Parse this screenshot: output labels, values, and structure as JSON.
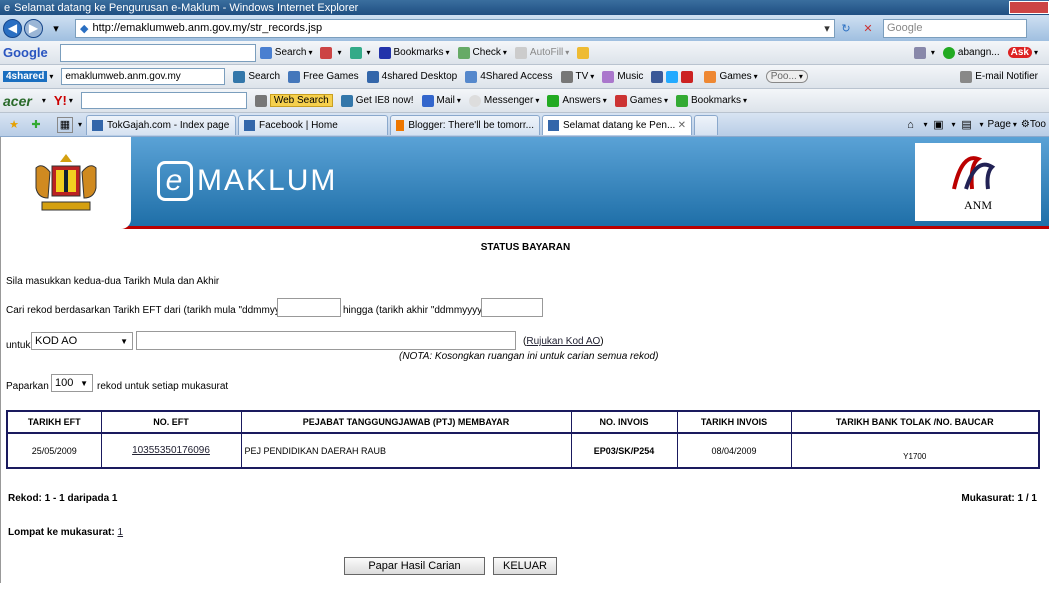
{
  "window": {
    "title": "Selamat datang ke Pengurusan e-Maklum - Windows Internet Explorer"
  },
  "address": {
    "url": "http://emaklumweb.anm.gov.my/str_records.jsp",
    "search_placeholder": "Google"
  },
  "google_toolbar": {
    "brand": "Google",
    "search": "Search",
    "bookmarks": "Bookmarks",
    "check": "Check",
    "autofill": "AutoFill",
    "user": "abangn...",
    "ask": "Ask",
    "email": "E-mail Notifier"
  },
  "shared_toolbar": {
    "brand": "4shared",
    "search_value": "emaklumweb.anm.gov.my",
    "search": "Search",
    "free_games": "Free Games",
    "desktop": "4shared Desktop",
    "access": "4Shared Access",
    "tv": "TV",
    "music": "Music",
    "games": "Games",
    "player": "Poo..."
  },
  "acer_toolbar": {
    "brand": "acer",
    "yahoo": "Y!",
    "web_search": "Web Search",
    "ie8": "Get IE8 now!",
    "mail": "Mail",
    "messenger": "Messenger",
    "answers": "Answers",
    "games": "Games",
    "bookmarks": "Bookmarks"
  },
  "tabs": [
    "TokGajah.com - Index page",
    "Facebook | Home",
    "Blogger: There'll be tomorr...",
    "Selamat datang ke Pen..."
  ],
  "command_bar": {
    "page": "Page",
    "tools": "Too"
  },
  "banner": {
    "logo_text": "MAKLUM",
    "logo_letter": "e",
    "partner": "ANM"
  },
  "page": {
    "title": "STATUS BAYARAN",
    "instruction": "Sila masukkan kedua-dua Tarikh Mula dan Akhir",
    "search_label": "Cari rekod berdasarkan Tarikh EFT dari  (tarikh mula \"ddmmyyyy\")",
    "until_label": "hingga (tarikh akhir \"ddmmyyyy\")",
    "for_label": "untuk",
    "kod_select": "KOD AO",
    "kod_link": "Rujukan Kod AO",
    "note": "(NOTA: Kosongkan ruangan ini untuk carian semua rekod)",
    "display_label": "Paparkan :",
    "display_value": "100",
    "display_suffix": "rekod untuk setiap mukasurat",
    "headers": [
      "TARIKH EFT",
      "NO. EFT",
      "PEJABAT TANGGUNGJAWAB (PTJ) MEMBAYAR",
      "NO. INVOIS",
      "TARIKH INVOIS",
      "TARIKH BANK TOLAK /NO. BAUCAR"
    ],
    "rows": [
      [
        "25/05/2009",
        "10355350176096",
        "PEJ PENDIDIKAN DAERAH RAUB",
        "EP03/SK/P254",
        "08/04/2009",
        "Y1700"
      ]
    ],
    "record_info": "Rekod: 1 - 1 daripada 1",
    "page_info": "Mukasurat: 1 / 1",
    "jump_label": "Lompat ke mukasurat:",
    "jump_page": "1",
    "btn_show": "Papar Hasil Carian",
    "btn_exit": "KELUAR"
  }
}
